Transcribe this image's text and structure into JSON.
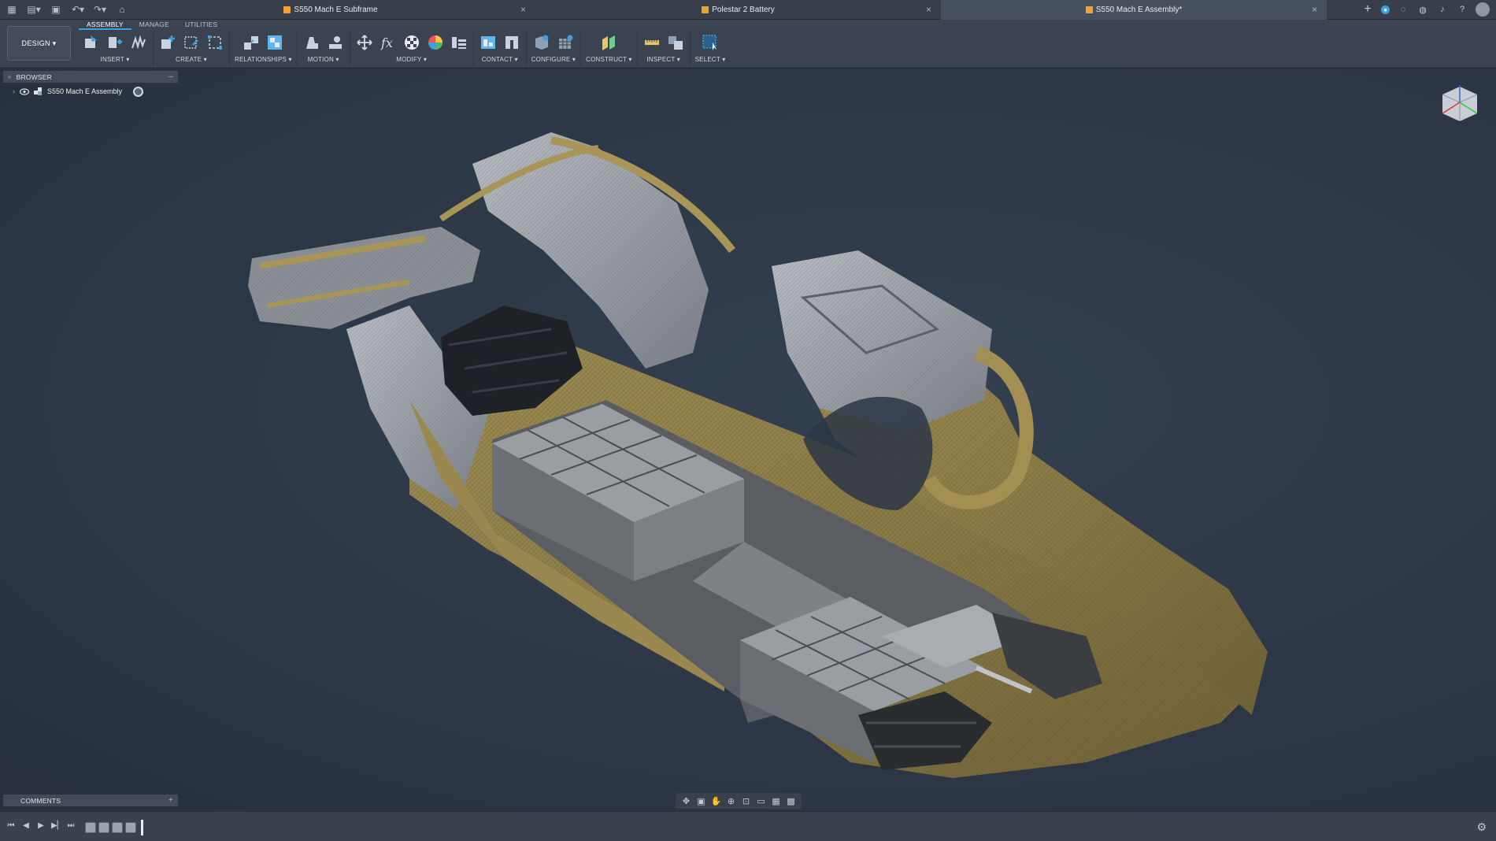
{
  "titlebar": {
    "tabs": [
      {
        "label": "S550 Mach E Subframe"
      },
      {
        "label": "Polestar 2 Battery"
      },
      {
        "label": "S550 Mach E Assembly*"
      }
    ]
  },
  "ribbon": {
    "workspace": "DESIGN",
    "tabs": [
      "ASSEMBLY",
      "MANAGE",
      "UTILITIES"
    ],
    "groups": [
      {
        "label": "INSERT"
      },
      {
        "label": "CREATE"
      },
      {
        "label": "RELATIONSHIPS"
      },
      {
        "label": "MOTION"
      },
      {
        "label": "MODIFY"
      },
      {
        "label": "CONTACT"
      },
      {
        "label": "CONFIGURE"
      },
      {
        "label": "CONSTRUCT"
      },
      {
        "label": "INSPECT"
      },
      {
        "label": "SELECT"
      }
    ]
  },
  "browser": {
    "header": "BROWSER",
    "root_item": "S550 Mach E Assembly"
  },
  "comments": {
    "header": "COMMENTS"
  },
  "colors": {
    "accent": "#3aa0e8",
    "body_gold": "#8a7a45",
    "body_grey": "#8e939a",
    "battery": "#8a8d92",
    "background": "#2c3644"
  },
  "icons": {
    "toolbar_right": [
      "add-tab-icon",
      "help-blue-icon",
      "jobs-icon",
      "extensions-icon",
      "notifications-icon",
      "help-icon",
      "avatar"
    ]
  }
}
